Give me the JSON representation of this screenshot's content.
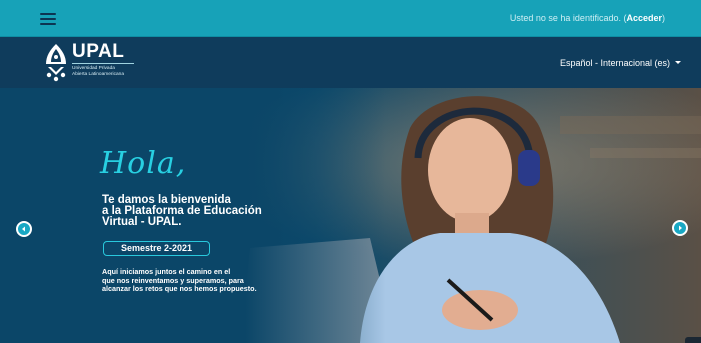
{
  "topbar": {
    "login_prefix": "Usted no se ha identificado. (",
    "login_link": "Acceder",
    "login_suffix": ")"
  },
  "header": {
    "logo_title": "UPAL",
    "logo_sub_line1": "Universidad Privada",
    "logo_sub_line2": "Abierta Latinoamericana",
    "language": "Español - Internacional (es)"
  },
  "slide": {
    "greeting": "Hola,",
    "welcome_lines": [
      "Te damos la bienvenida",
      "a la Plataforma de Educación",
      "Virtual - UPAL."
    ],
    "semester": "Semestre 2-2021",
    "description_lines": [
      "Aquí iniciamos juntos el camino en el",
      "que nos reinventamos y superamos, para",
      "alcanzar los retos que nos hemos propuesto."
    ]
  },
  "colors": {
    "topbar": "#17a2b8",
    "header": "#0f3c5c",
    "accent": "#28d0e2"
  }
}
